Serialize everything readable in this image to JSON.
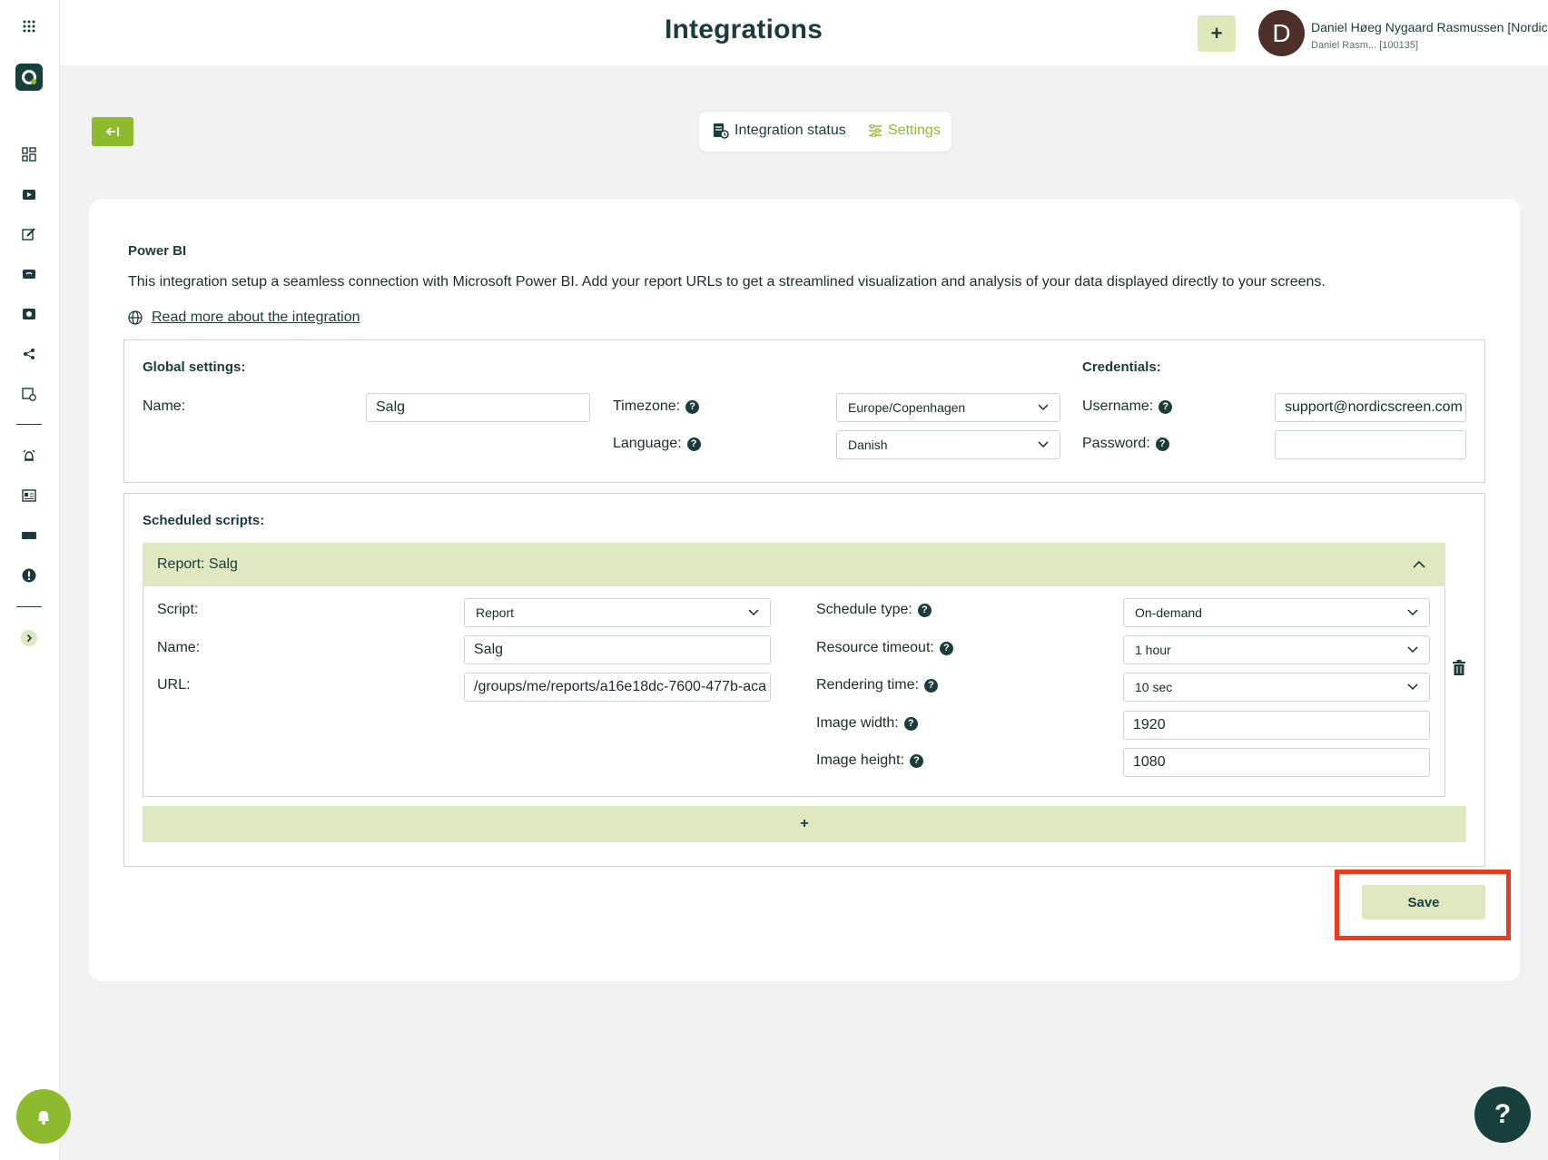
{
  "header": {
    "title": "Integrations",
    "add_label": "+",
    "avatar_initial": "D",
    "user_name": "Daniel Høeg Nygaard Rasmussen [NordicScreen]",
    "user_sub": "Daniel Rasm... [100135]"
  },
  "sidebar": {
    "icons": [
      "grid-menu-icon",
      "dashboard-icon",
      "player-icon",
      "edit-icon",
      "media-icon",
      "playlist-icon",
      "share-icon",
      "schedule-icon",
      "alarm-icon",
      "news-icon",
      "display-icon",
      "alert-icon",
      "expand-icon"
    ]
  },
  "tabs": {
    "status_label": "Integration status",
    "settings_label": "Settings"
  },
  "integration": {
    "title": "Power BI",
    "description": "This integration setup a seamless connection with Microsoft Power BI. Add your report URLs to get a streamlined visualization and analysis of your data displayed directly to your screens.",
    "read_more": "Read more about the integration"
  },
  "global_settings": {
    "heading": "Global settings:",
    "name_label": "Name:",
    "name_value": "Salg",
    "timezone_label": "Timezone:",
    "timezone_value": "Europe/Copenhagen",
    "language_label": "Language:",
    "language_value": "Danish"
  },
  "credentials": {
    "heading": "Credentials:",
    "username_label": "Username:",
    "username_value": "support@nordicscreen.com",
    "password_label": "Password:",
    "password_value": ""
  },
  "scheduled": {
    "heading": "Scheduled scripts:",
    "report_title": "Report: Salg",
    "script_label": "Script:",
    "script_value": "Report",
    "name_label": "Name:",
    "name_value": "Salg",
    "url_label": "URL:",
    "url_value": "/groups/me/reports/a16e18dc-7600-477b-aca",
    "schedule_type_label": "Schedule type:",
    "schedule_type_value": "On-demand",
    "resource_timeout_label": "Resource timeout:",
    "resource_timeout_value": "1 hour",
    "rendering_time_label": "Rendering time:",
    "rendering_time_value": "10 sec",
    "image_width_label": "Image width:",
    "image_width_value": "1920",
    "image_height_label": "Image height:",
    "image_height_value": "1080",
    "add_label": "+"
  },
  "actions": {
    "save_label": "Save",
    "help_label": "?"
  },
  "colors": {
    "accent": "#8dbb2d",
    "dark": "#1d3b3a",
    "pale": "#dfe8c0",
    "highlight": "#ee3a1c"
  }
}
